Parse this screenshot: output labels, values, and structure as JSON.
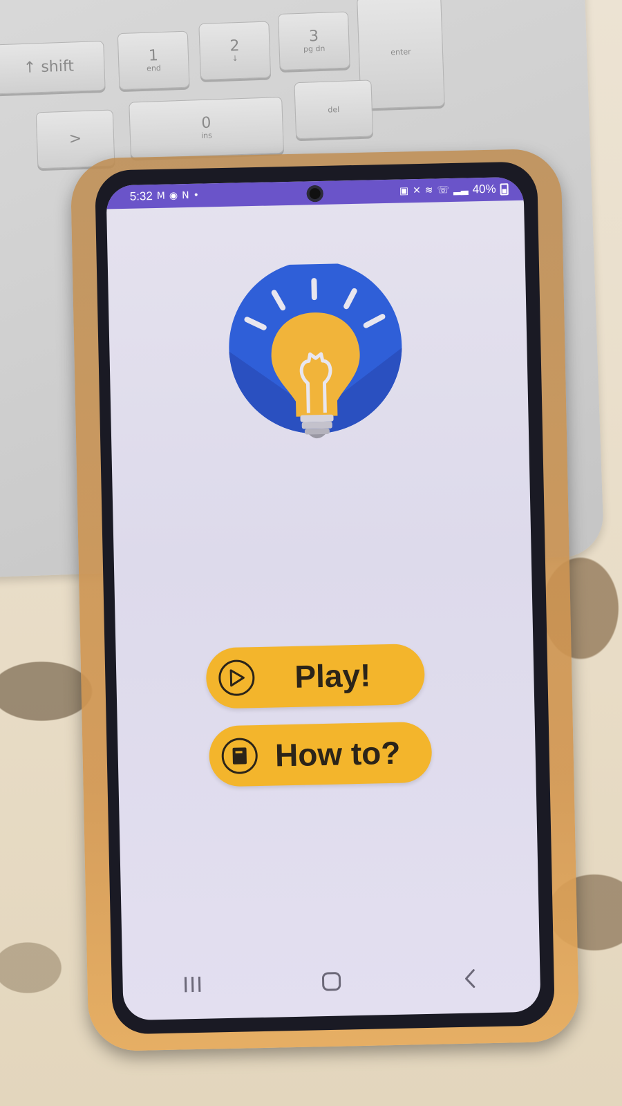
{
  "status_bar": {
    "time": "5:32",
    "battery_percent": "40%"
  },
  "app": {
    "logo": {
      "icon": "lightbulb-icon",
      "colors": {
        "circle": "#2f5fd8",
        "bulb": "#f1b43a"
      }
    },
    "buttons": [
      {
        "id": "play",
        "label": "Play!",
        "icon": "play-icon"
      },
      {
        "id": "howto",
        "label": "How to?",
        "icon": "book-icon"
      }
    ],
    "accent_color": "#f3b52c"
  },
  "navigation_bar": {
    "items": [
      {
        "id": "recents",
        "icon": "recents-icon"
      },
      {
        "id": "home",
        "icon": "home-icon"
      },
      {
        "id": "back",
        "icon": "back-icon"
      }
    ]
  },
  "background": {
    "keyboard_keys": [
      {
        "main": "1",
        "sub": "end"
      },
      {
        "main": "2",
        "sub": "↓"
      },
      {
        "main": "3",
        "sub": "pg dn"
      },
      {
        "main": "0",
        "sub": "ins"
      },
      {
        "main": "",
        "sub": "del"
      },
      {
        "main": "↑ shift",
        "sub": ""
      },
      {
        "main": ">",
        "sub": ""
      },
      {
        "main": "",
        "sub": "enter"
      }
    ]
  }
}
